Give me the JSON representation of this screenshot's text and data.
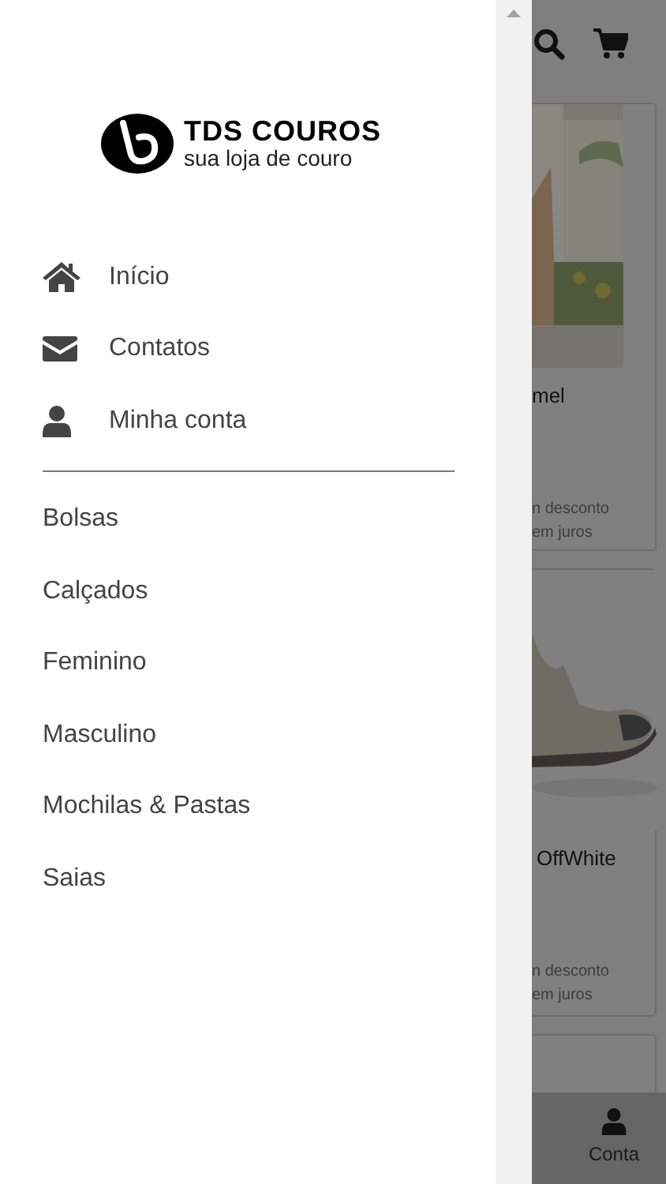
{
  "drawer": {
    "logo": {
      "title": "TDS COUROS",
      "tagline": "sua loja de couro"
    },
    "nav_items": [
      {
        "kind": "home",
        "label": "Início"
      },
      {
        "kind": "mail",
        "label": "Contatos"
      },
      {
        "kind": "user",
        "label": "Minha conta"
      }
    ],
    "categories": [
      "Bolsas",
      "Calçados",
      "Feminino",
      "Masculino",
      "Mochilas & Pastas",
      "Saias"
    ]
  },
  "page": {
    "products": [
      {
        "kind": "dress",
        "name": "mel",
        "price_note": "n desconto",
        "installments": "em juros"
      },
      {
        "kind": "shoe",
        "name": "OffWhite",
        "price_note": "n desconto",
        "installments": "em juros"
      }
    ],
    "bottom_nav": {
      "label": "Conta"
    }
  }
}
